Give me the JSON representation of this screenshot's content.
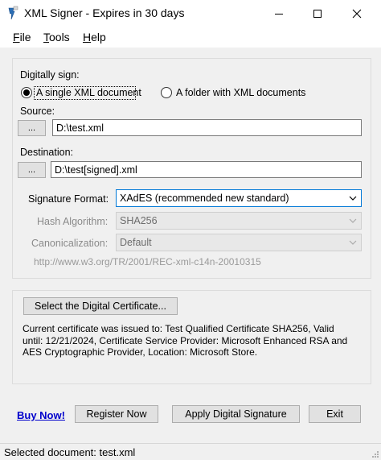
{
  "window": {
    "title": "XML Signer - Expires in 30 days"
  },
  "menu": {
    "file": {
      "hotkey": "F",
      "rest": "ile"
    },
    "tools": {
      "hotkey": "T",
      "rest": "ools"
    },
    "help": {
      "hotkey": "H",
      "rest": "elp"
    }
  },
  "sign": {
    "section_label": "Digitally sign:",
    "options": {
      "single": "A single XML document",
      "folder": "A folder with XML documents"
    },
    "selected": "single",
    "source_label": "Source:",
    "source_value": "D:\\test.xml",
    "destination_label": "Destination:",
    "destination_value": "D:\\test[signed].xml",
    "browse_label": "...",
    "signature_format_label": "Signature Format:",
    "signature_format_value": "XAdES (recommended new standard)",
    "hash_algorithm_label": "Hash Algorithm:",
    "hash_algorithm_value": "SHA256",
    "canonicalization_label": "Canonicalization:",
    "canonicalization_value": "Default",
    "canonicalization_url": "http://www.w3.org/TR/2001/REC-xml-c14n-20010315"
  },
  "certificate": {
    "select_button": "Select the Digital Certificate...",
    "info": "Current certificate was issued to: Test Qualified Certificate SHA256, Valid until: 12/21/2024, Certificate Service Provider: Microsoft Enhanced RSA and AES Cryptographic Provider, Location: Microsoft Store."
  },
  "actions": {
    "buy_now": "Buy Now!",
    "register": "Register Now",
    "apply": "Apply Digital Signature",
    "exit": "Exit"
  },
  "status": {
    "text": "Selected document: test.xml"
  },
  "colors": {
    "background": "#f0f0f0",
    "link": "#0000cc",
    "focus_border": "#0078d7"
  }
}
